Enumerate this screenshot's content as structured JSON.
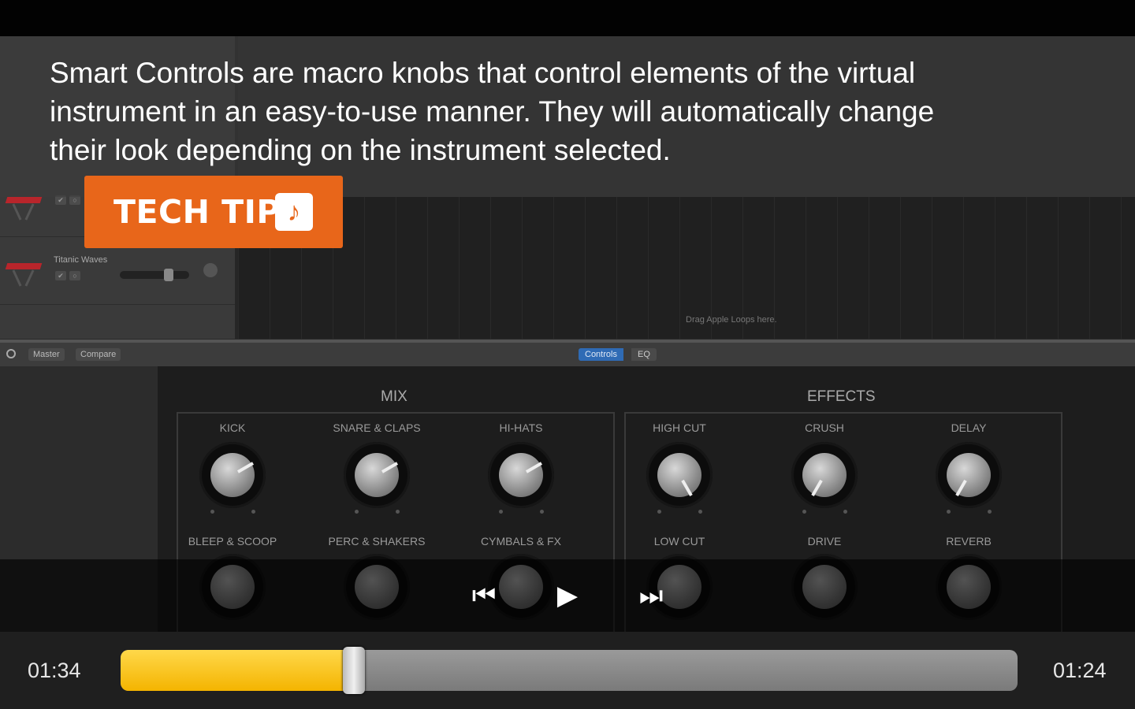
{
  "caption": {
    "text_line1": "Smart Controls are macro knobs that control elements of the virtual",
    "text_line2": "instrument in an easy-to-use manner. They will automatically change",
    "text_line3": "their look depending on the instrument selected.",
    "badge_label": "TECH TIP",
    "badge_color": "#e8661a"
  },
  "tracks": {
    "items": [
      {
        "name": "",
        "controls": [
          "✔",
          "○"
        ]
      },
      {
        "name": "Titanic Waves",
        "controls": [
          "✔",
          "○"
        ]
      }
    ],
    "drag_hint": "Drag Apple Loops here."
  },
  "smart_controls": {
    "header_buttons": [
      "Master",
      "Compare"
    ],
    "view_tabs": {
      "active": "Controls",
      "inactive": "EQ"
    },
    "mix": {
      "title": "MIX",
      "top_labels": [
        "KICK",
        "SNARE & CLAPS",
        "HI-HATS"
      ],
      "bottom_labels": [
        "BLEEP & SCOOP",
        "PERC & SHAKERS",
        "CYMBALS & FX"
      ]
    },
    "effects": {
      "title": "EFFECTS",
      "top_labels": [
        "HIGH CUT",
        "CRUSH",
        "DELAY"
      ],
      "bottom_labels": [
        "LOW CUT",
        "DRIVE",
        "REVERB"
      ]
    }
  },
  "player": {
    "elapsed": "01:34",
    "remaining": "01:24",
    "progress_fraction": 0.26,
    "progress_color": "#f4b400",
    "icons": [
      "skip-back-icon",
      "play-icon",
      "skip-forward-icon"
    ]
  }
}
